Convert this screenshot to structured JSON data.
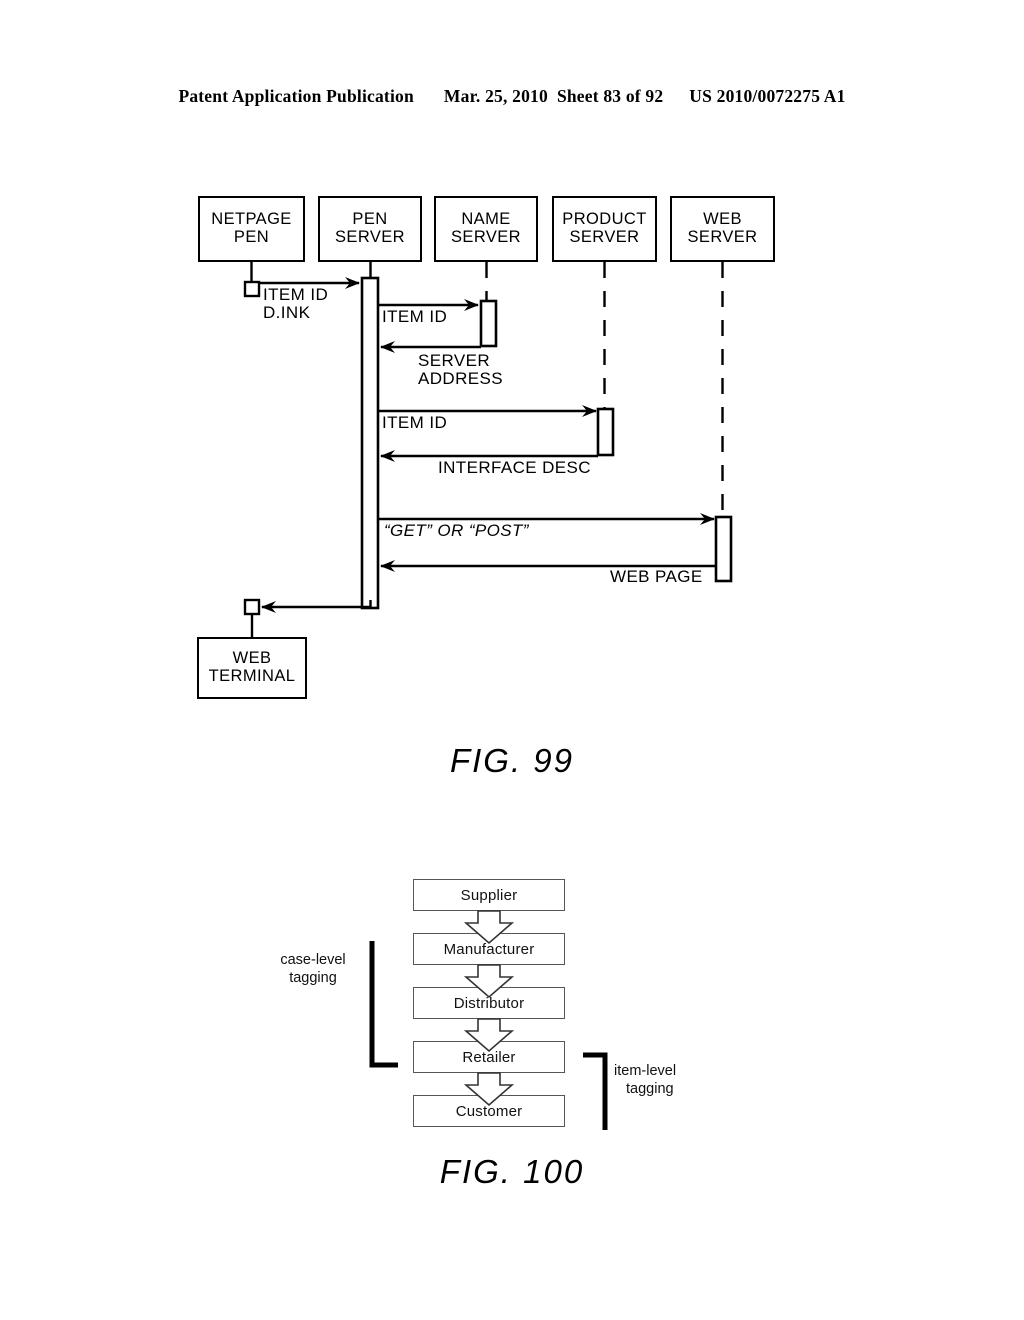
{
  "header": {
    "publication": "Patent Application Publication",
    "date": "Mar. 25, 2010",
    "sheet": "Sheet 83 of 92",
    "patent_number": "US 2010/0072275 A1"
  },
  "fig99": {
    "caption": "FIG. 99",
    "participants": [
      {
        "id": "netpage-pen",
        "line1": "NETPAGE",
        "line2": "PEN"
      },
      {
        "id": "pen-server",
        "line1": "PEN",
        "line2": "SERVER"
      },
      {
        "id": "name-server",
        "line1": "NAME",
        "line2": "SERVER"
      },
      {
        "id": "product-server",
        "line1": "PRODUCT",
        "line2": "SERVER"
      },
      {
        "id": "web-server",
        "line1": "WEB",
        "line2": "SERVER"
      }
    ],
    "terminal": {
      "line1": "WEB",
      "line2": "TERMINAL"
    },
    "messages": [
      {
        "id": "m1",
        "label_line1": "ITEM ID",
        "label_line2": "D.INK",
        "from": "netpage-pen",
        "to": "pen-server",
        "direction": "right"
      },
      {
        "id": "m2",
        "label_line1": "ITEM ID",
        "label_line2": "",
        "from": "pen-server",
        "to": "name-server",
        "direction": "right"
      },
      {
        "id": "m3",
        "label_line1": "SERVER",
        "label_line2": "ADDRESS",
        "from": "name-server",
        "to": "pen-server",
        "direction": "left"
      },
      {
        "id": "m4",
        "label_line1": "ITEM ID",
        "label_line2": "",
        "from": "pen-server",
        "to": "product-server",
        "direction": "right"
      },
      {
        "id": "m5",
        "label_line1": "INTERFACE DESC",
        "label_line2": "",
        "from": "product-server",
        "to": "pen-server",
        "direction": "left"
      },
      {
        "id": "m6",
        "label_line1": "“GET” OR “POST”",
        "label_line2": "",
        "from": "pen-server",
        "to": "web-server",
        "direction": "right"
      },
      {
        "id": "m7",
        "label_line1": "WEB PAGE",
        "label_line2": "",
        "from": "web-server",
        "to": "pen-server",
        "direction": "left"
      },
      {
        "id": "m8",
        "label_line1": "",
        "label_line2": "",
        "from": "pen-server",
        "to": "web-terminal",
        "direction": "left"
      }
    ]
  },
  "fig100": {
    "caption": "FIG. 100",
    "stages": [
      {
        "id": "supplier",
        "label": "Supplier"
      },
      {
        "id": "manufacturer",
        "label": "Manufacturer"
      },
      {
        "id": "distributor",
        "label": "Distributor"
      },
      {
        "id": "retailer",
        "label": "Retailer"
      },
      {
        "id": "customer",
        "label": "Customer"
      }
    ],
    "brackets": [
      {
        "id": "case-level",
        "line1": "case-level",
        "line2": "tagging",
        "spans": [
          "supplier",
          "manufacturer",
          "distributor",
          "retailer"
        ]
      },
      {
        "id": "item-level",
        "line1": "item-level",
        "line2": "tagging",
        "spans": [
          "retailer",
          "customer"
        ]
      }
    ]
  },
  "colors": {
    "ink": "#000000",
    "flow_border": "#555555",
    "background": "#ffffff"
  }
}
